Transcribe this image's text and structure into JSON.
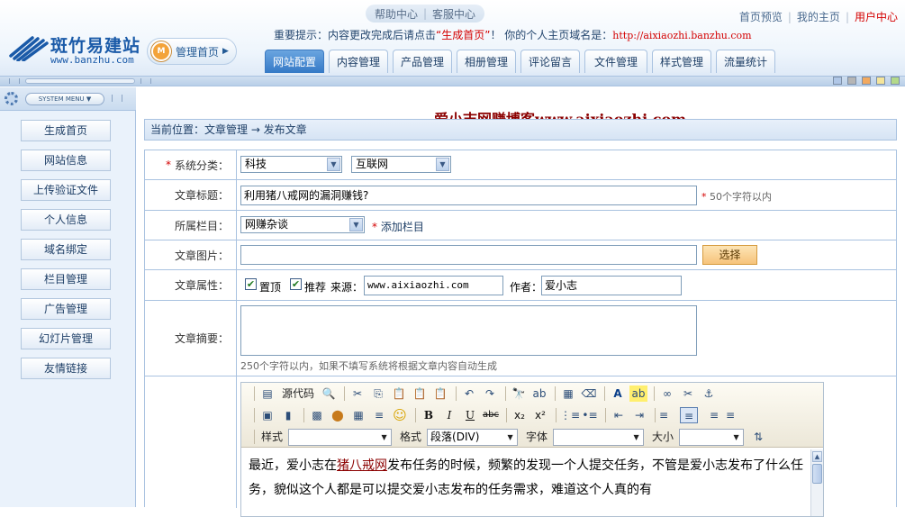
{
  "header": {
    "logo_name": "斑竹易建站",
    "logo_domain": "www.banzhu.com",
    "mgmt_icon": "M",
    "mgmt_label": "管理首页",
    "mgmt_arrow": "▶",
    "help": [
      "帮助中心",
      "客服中心"
    ],
    "help_sep": "|",
    "top_links": [
      "首页预览",
      "我的主页",
      "用户中心"
    ],
    "top_sep": "|",
    "notice_prefix": "重要提示：内容更改完成后请点击",
    "notice_highlight": "“生成首页”",
    "notice_mid": "！ 你的个人主页域名是：",
    "notice_domain": "http://aixiaozhi.banzhu.com",
    "tabs": [
      "网站配置",
      "内容管理",
      "产品管理",
      "相册管理",
      "评论留言",
      "文件管理",
      "样式管理",
      "流量统计"
    ],
    "active_tab": 0,
    "skin_colors": [
      "#b0c7e7",
      "#b5b5b5",
      "#f2a95f",
      "#f5e59a",
      "#b3d98a"
    ]
  },
  "sidebar": {
    "menu_label": "SYSTEM MENU ▼",
    "items": [
      "生成首页",
      "网站信息",
      "上传验证文件",
      "个人信息",
      "域名绑定",
      "栏目管理",
      "广告管理",
      "幻灯片管理",
      "友情链接"
    ]
  },
  "main": {
    "watermark": "爱小志网赚博客www.aixiaozhi.com",
    "breadcrumb": "当前位置：文章管理 → 发布文章",
    "form": {
      "category_label": "系统分类：",
      "category_primary": "科技",
      "category_secondary": "互联网",
      "title_label": "文章标题：",
      "title_value": "利用猪八戒网的漏洞赚钱?",
      "title_hint": "50个字符以内",
      "column_label": "所属栏目：",
      "column_value": "网赚杂谈",
      "add_column": "添加栏目",
      "image_label": "文章图片：",
      "image_value": "",
      "choose_button": "选择",
      "attr_label": "文章属性：",
      "attr_top": "置顶",
      "attr_recommend": "推荐",
      "source_label": "来源：",
      "source_value": "www.aixiaozhi.com",
      "author_label": "作者：",
      "author_value": "爱小志",
      "summary_label": "文章摘要：",
      "summary_value": "",
      "summary_hint": "250个字符以内，如果不填写系统将根据文章内容自动生成",
      "required_mark": "*",
      "check_mark": "✔",
      "dropdown_arrow": "▼"
    },
    "editor": {
      "source_label": "源代码",
      "style_label": "样式",
      "format_label": "格式",
      "format_value": "段落(DIV)",
      "font_label": "字体",
      "size_label": "大小",
      "tool_glyphs": {
        "source_code": "▤",
        "preview": "🔍",
        "cut": "✂",
        "copy": "⎘",
        "paste": "📋",
        "paste_text": "📋",
        "paste_word": "📋",
        "undo": "↶",
        "redo": "↷",
        "find": "🔭",
        "replace": "ab",
        "select_all": "▦",
        "remove_format": "⌫",
        "text_color": "A",
        "bg_color": "ab",
        "link": "∞",
        "unlink": "✂",
        "anchor": "⚓",
        "image": "▣",
        "flash": "▮",
        "media": "▩",
        "template": "⬤",
        "table": "▦",
        "hr": "≡",
        "smiley": "☺",
        "bold": "B",
        "italic": "I",
        "underline": "U",
        "strike": "abc",
        "subscript": "x₂",
        "superscript": "x²",
        "ol": "⋮≡",
        "ul": "•≡",
        "outdent": "⇤",
        "indent": "⇥",
        "align_left": "≡",
        "align_center": "≡",
        "align_right": "≡",
        "justify": "≡",
        "show_blocks": "⇅",
        "scroll_up": "▲"
      },
      "content_before_link": "最近，爱小志在",
      "content_link": "猪八戒网",
      "content_after_link": "发布任务的时候，频繁的发现一个人提交任务，不管是爱小志发布了什么任务，貌似这个人都是可以提交爱小志发布的任务需求，难道这个人真的有"
    }
  }
}
